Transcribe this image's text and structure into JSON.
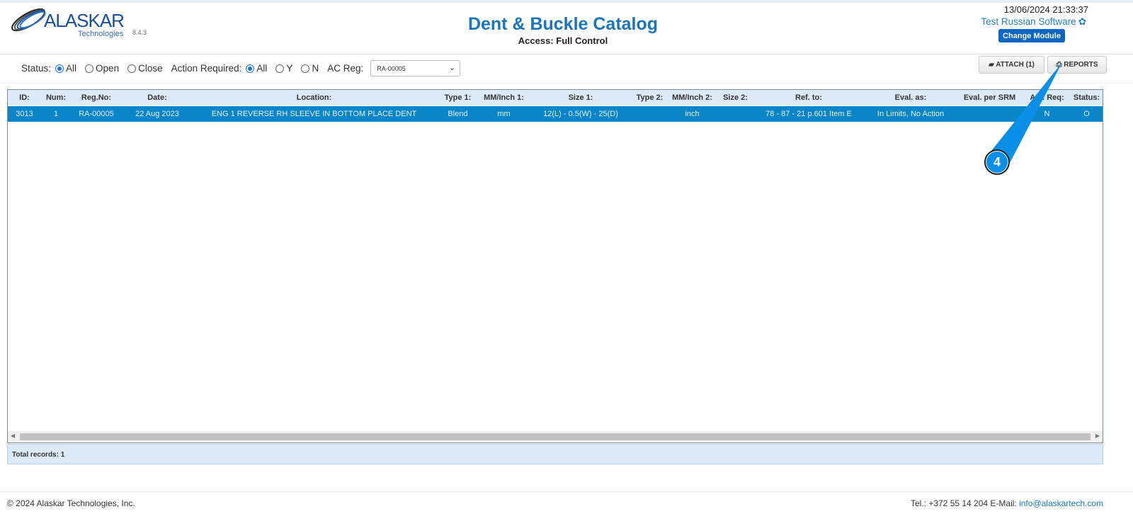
{
  "header": {
    "logo_text": "ALASKAR",
    "logo_sub": "Technologies",
    "version": "8.4.3",
    "title": "Dent & Buckle Catalog",
    "access": "Access: Full Control",
    "datetime": "13/06/2024 21:33:37",
    "user": "Test Russian Software",
    "change_module": "Change Module"
  },
  "filters": {
    "status_label": "Status:",
    "status_options": [
      "All",
      "Open",
      "Close"
    ],
    "status_selected": "All",
    "action_label": "Action Required:",
    "action_options": [
      "All",
      "Y",
      "N"
    ],
    "action_selected": "All",
    "acreg_label": "AC Reg:",
    "acreg_value": "RA-00005"
  },
  "toolbar": {
    "attach": "ATTACH (1)",
    "reports": "REPORTS"
  },
  "table": {
    "columns": [
      "ID:",
      "Num:",
      "Reg.No:",
      "Date:",
      "Location:",
      "Type 1:",
      "MM/Inch 1:",
      "Size 1:",
      "Type 2:",
      "MM/Inch 2:",
      "Size 2:",
      "Ref. to:",
      "Eval. as:",
      "Eval. per SRM",
      "Act. Req:",
      "Status:"
    ],
    "rows": [
      [
        "3013",
        "1",
        "RA-00005",
        "22 Aug 2023",
        "ENG 1 REVERSE RH SLEEVE IN BOTTOM PLACE DENT",
        "Blend",
        "mm",
        "12(L) - 0.5(W) - 25(D)",
        "",
        "inch",
        "",
        "78 - 87 - 21 p.601 Item E",
        "In Limits, No Action",
        "",
        "N",
        "O"
      ]
    ]
  },
  "total": "Total records: 1",
  "annotation": {
    "step": "4"
  },
  "footer": {
    "copyright": "© 2024 Alaskar Technologies, Inc.",
    "contact": "Tel.: +372 55 14 204 E-Mail:",
    "email": "info@alaskartech.com"
  }
}
